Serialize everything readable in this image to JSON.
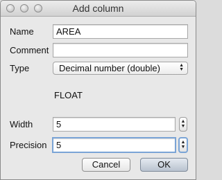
{
  "window": {
    "title": "Add column"
  },
  "form": {
    "name_label": "Name",
    "name_value": "AREA",
    "comment_label": "Comment",
    "comment_value": "",
    "type_label": "Type",
    "type_selected": "Decimal number (double)",
    "type_sql": "FLOAT",
    "width_label": "Width",
    "width_value": "5",
    "precision_label": "Precision",
    "precision_value": "5"
  },
  "buttons": {
    "cancel": "Cancel",
    "ok": "OK"
  },
  "icons": {
    "stepper": "up-down-arrows-icon",
    "select": "select-arrows-icon"
  }
}
